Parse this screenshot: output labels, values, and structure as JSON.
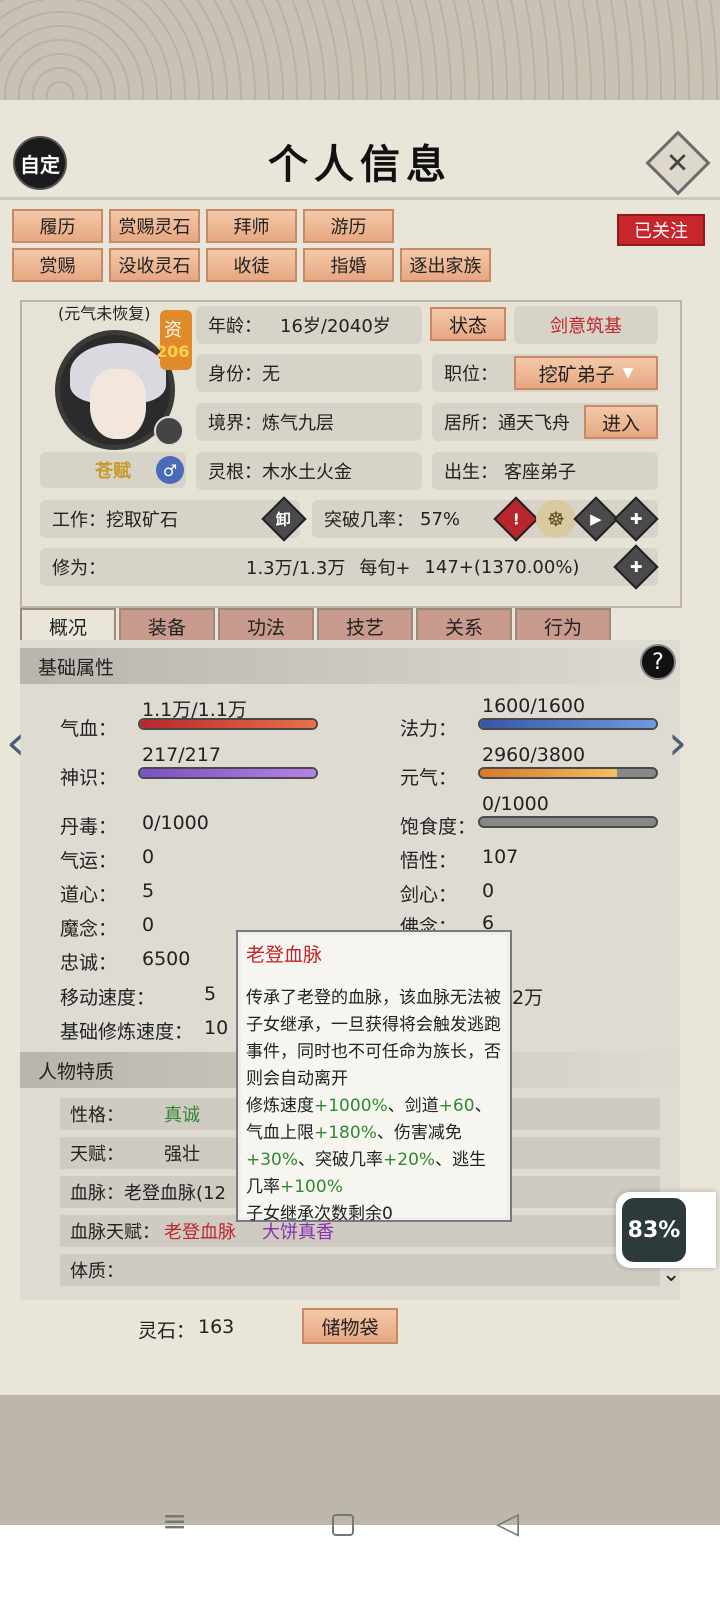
{
  "header": {
    "auto_label": "自定",
    "title": "个人信息",
    "close_icon": "close-icon"
  },
  "actions": {
    "row1": [
      "履历",
      "赏赐灵石",
      "拜师",
      "游历"
    ],
    "row2": [
      "赏赐",
      "没收灵石",
      "收徒",
      "指婚",
      "逐出家族"
    ],
    "follow": "已关注"
  },
  "profile": {
    "vitality_status": "(元气未恢复)",
    "aptitude_label": "资",
    "aptitude_value": "206",
    "name": "苍赋",
    "gender_icon": "male-icon",
    "age_label": "年龄：",
    "age_value": "16岁/2040岁",
    "status_btn": "状态",
    "status_value": "剑意筑基",
    "identity_label": "身份：",
    "identity_value": "无",
    "post_label": "职位：",
    "post_value": "挖矿弟子",
    "realm_label": "境界：",
    "realm_value": "炼气九层",
    "residence_label": "居所：",
    "residence_value": "通天飞舟",
    "enter_btn": "进入",
    "root_label": "灵根：",
    "root_value": "木水土火金",
    "birth_label": "出生：",
    "birth_value": "客座弟子",
    "work_label": "工作：",
    "work_value": "挖取矿石",
    "unload_label": "卸",
    "breakthrough_label": "突破几率：",
    "breakthrough_value": "57%",
    "cultivation_label": "修为：",
    "cultivation_value": "1.3万/1.3万",
    "per_period_label": "每旬+",
    "per_period_value": "147+(1370.00%)"
  },
  "tabs": [
    "概况",
    "装备",
    "功法",
    "技艺",
    "关系",
    "行为"
  ],
  "base_attrs": {
    "title": "基础属性",
    "hp_label": "气血：",
    "hp_value": "1.1万/1.1万",
    "hp_fill": 1.0,
    "mana_label": "法力：",
    "mana_value": "1600/1600",
    "mana_fill": 1.0,
    "sense_label": "神识：",
    "sense_value": "217/217",
    "sense_fill": 1.0,
    "qi_label": "元气：",
    "qi_value": "2960/3800",
    "qi_fill": 0.78,
    "satiety_label": "饱食度：",
    "satiety_value": "0/1000",
    "satiety_fill": 0.0,
    "poison_label": "丹毒：",
    "poison_value": "0/1000",
    "luck_label": "气运：",
    "luck_value": "0",
    "wisdom_label": "悟性：",
    "wisdom_value": "107",
    "dao_label": "道心：",
    "dao_value": "5",
    "sword_label": "剑心：",
    "sword_value": "0",
    "demon_label": "魔念：",
    "demon_value": "0",
    "buddha_label": "佛念：",
    "buddha_value": "6",
    "loyalty_label": "忠诚：",
    "loyalty_value": "6500",
    "move_label": "移动速度：",
    "move_value": "5",
    "right_partial": "2万",
    "train_label": "基础修炼速度：",
    "train_value": "10"
  },
  "traits": {
    "title": "人物特质",
    "personality_label": "性格：",
    "personality_value": "真诚",
    "talent_label": "天赋：",
    "talent_value": "强壮",
    "bloodline_label": "血脉：",
    "bloodline_value": "老登血脉(12",
    "bloodline_talent_label": "血脉天赋：",
    "bloodline_talent_1": "老登血脉",
    "bloodline_talent_2": "大饼真香",
    "constitution_label": "体质："
  },
  "tooltip": {
    "title": "老登血脉",
    "line1": "传承了老登的血脉，该血脉无法被子女继承，一旦获得将会触发逃跑事件，同时也不可任命为族长，否则会自动离开",
    "line2a": "修炼速度",
    "line2b": "+1000%",
    "line2c": "、剑道",
    "line2d": "+60",
    "line2e": "、气血上限",
    "line2f": "+180%",
    "line2g": "、伤害减免",
    "line2h": "+30%",
    "line2i": "、突破几率",
    "line2j": "+20%",
    "line2k": "、逃生几率",
    "line2l": "+100%",
    "line3": "子女继承次数剩余0"
  },
  "footer": {
    "spirit_stone_label": "灵石：",
    "spirit_stone_value": "163",
    "bag_btn": "储物袋"
  },
  "overlay": {
    "percent": "83%"
  }
}
